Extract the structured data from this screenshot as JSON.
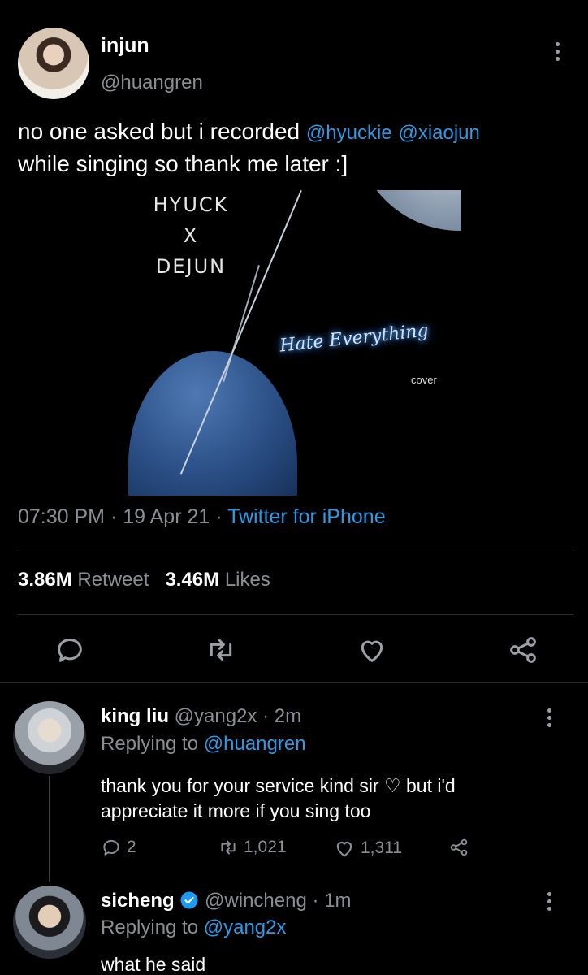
{
  "tweet": {
    "name": "injun",
    "handle": "@huangren",
    "text_main": "no one asked but i recorded",
    "mention1": "@hyuckie",
    "mention2": "@xiaojun",
    "text_line2": "while singing so thank me later :]",
    "media": {
      "title_line1": "HYUCK",
      "title_line2": "X",
      "title_line3": "DEJUN",
      "script_title": "Hate Everything",
      "subtitle": "cover"
    },
    "time": "07:30 PM",
    "date": "19 Apr 21",
    "source": "Twitter for iPhone",
    "retweets": "3.86M",
    "retweet_label": "Retweet",
    "likes": "3.46M",
    "likes_label": "Likes"
  },
  "replies": [
    {
      "name": "king liu",
      "handle": "@yang2x",
      "time": "2m",
      "replying_label": "Replying to",
      "replying_to": "@huangren",
      "text_line1": "thank you for your service kind sir",
      "text_line1b": "but i'd",
      "text_line2": "appreciate it more if you sing too",
      "replies": "2",
      "retweets": "1,021",
      "likes": "1,311"
    },
    {
      "name": "sicheng",
      "handle": "@wincheng",
      "time": "1m",
      "replying_label": "Replying to",
      "replying_to": "@yang2x",
      "text": "what he said"
    }
  ],
  "colors": {
    "background": "#000000",
    "accent": "#2e9ae6",
    "secondary_text": "#8b8f94",
    "verified": "#1d9bf0"
  },
  "icons": [
    "reply-icon",
    "retweet-icon",
    "like-icon",
    "share-icon",
    "more-icon",
    "verified-icon"
  ]
}
